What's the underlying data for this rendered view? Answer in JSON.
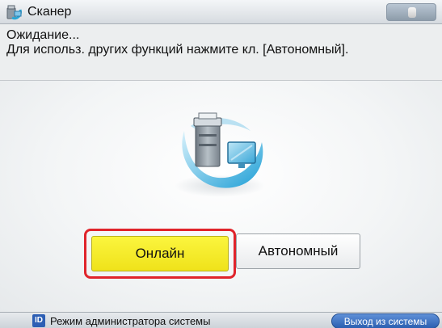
{
  "window": {
    "title": "Сканер",
    "icon": "scanner-icon"
  },
  "message": {
    "line1": "Ожидание...",
    "line2": "Для использ. других функций нажмите кл. [Автономный]."
  },
  "modes": {
    "selected": "online",
    "online_label": "Онлайн",
    "offline_label": "Автономный"
  },
  "status_bar": {
    "admin_icon": "ID",
    "admin_text": "Режим администратора системы",
    "logout_label": "Выход из системы"
  },
  "colors": {
    "selected_button": "#f5ec2a",
    "selection_outline": "#e0242b",
    "logout_button": "#2b5fb0"
  }
}
